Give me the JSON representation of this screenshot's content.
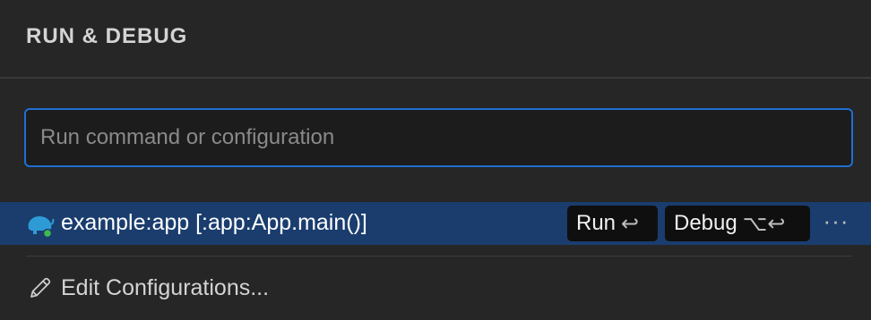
{
  "panel": {
    "title": "RUN & DEBUG"
  },
  "search": {
    "placeholder": "Run command or configuration",
    "value": ""
  },
  "configuration": {
    "label": "example:app [:app:App.main()]",
    "icon": "gradle-elephant-icon",
    "status_color": "#3fb950",
    "run_label": "Run",
    "run_shortcut": "↩",
    "debug_label": "Debug",
    "debug_shortcut": "⌥↩",
    "more_label": "···"
  },
  "edit": {
    "label": "Edit Configurations...",
    "icon": "pencil-icon"
  },
  "colors": {
    "accent": "#1f6fd1",
    "selected_row": "#1a3d6e",
    "background": "#262626"
  }
}
